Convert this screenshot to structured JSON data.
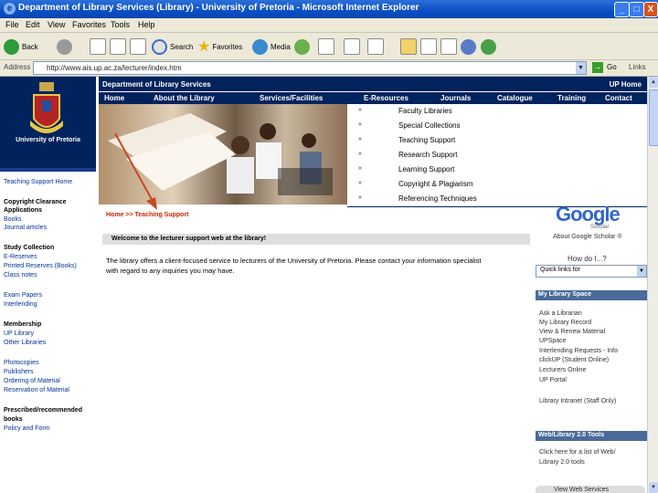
{
  "window": {
    "title": "Department of Library Services (Library) - University of Pretoria - Microsoft Internet Explorer",
    "min": "_",
    "max": "□",
    "close": "X"
  },
  "menu": [
    "File",
    "Edit",
    "View",
    "Favorites",
    "Tools",
    "Help"
  ],
  "toolbar": {
    "back": "Back",
    "search": "Search",
    "favorites": "Favorites",
    "media": "Media"
  },
  "address": {
    "label": "Address",
    "url": "http://www.ais.up.ac.za/lecturer/index.htm",
    "go": "Go",
    "links": "Links"
  },
  "site": {
    "logo_text": "University of Pretoria",
    "dept": "Department of Library Services",
    "up_home": "UP Home",
    "tabs": [
      "Home",
      "About the Library",
      "Services/Facilities",
      "E-Resources",
      "Journals",
      "Catalogue",
      "Training",
      "Contact"
    ],
    "dropdown": [
      "Faculty Libraries",
      "Special Collections",
      "Teaching Support",
      "Research Support",
      "Learning Support",
      "Copyright & Plagiarism",
      "Referencing Techniques"
    ],
    "dropdown_bullet": "»"
  },
  "leftnav": [
    {
      "text": "Teaching Support Home",
      "h": false
    },
    {
      "text": "Copyright Clearance",
      "h": true
    },
    {
      "text": "Applications",
      "h": true
    },
    {
      "text": "Books",
      "h": false
    },
    {
      "text": "Journal articles",
      "h": false
    },
    {
      "text": "Study Collection",
      "h": true
    },
    {
      "text": "E-Reserves",
      "h": false
    },
    {
      "text": "Printed Reserves (Books)",
      "h": false
    },
    {
      "text": "Class notes",
      "h": false
    },
    {
      "text": "Exam Papers",
      "h": false
    },
    {
      "text": "Interlending",
      "h": false
    },
    {
      "text": "Membership",
      "h": true
    },
    {
      "text": "UP Library",
      "h": false
    },
    {
      "text": "Other Libraries",
      "h": false
    },
    {
      "text": "Photocopies",
      "h": false
    },
    {
      "text": "Publishers",
      "h": false
    },
    {
      "text": "Ordering of Material",
      "h": false
    },
    {
      "text": "Reservation of Material",
      "h": false
    },
    {
      "text": "Prescribed/recommended",
      "h": true
    },
    {
      "text": "books",
      "h": true
    },
    {
      "text": "Policy and Form",
      "h": false
    }
  ],
  "main": {
    "breadcrumb": "Home >> Teaching Support",
    "welcome": "Welcome to the lecturer support web at the library!",
    "intro": "The library offers a client-focused service to lecturers of the University of Pretoria. Please contact your information specialist with regard to any inquiries you may have."
  },
  "right": {
    "google_logo": "Google",
    "google_sub": "Scholar",
    "about_gs": "About Google Scholar ®",
    "how_do_i": "How do I...?",
    "quick_select": "Quick links for",
    "my_library_space": "My Library Space",
    "my_library_items": [
      "Ask a Librarian",
      "My Library Record",
      "View & Renew Material",
      "UPSpace",
      "Interlending Requests - Info",
      "clickUP (Student Online)",
      "Lecturers Online",
      "UP Portal",
      "Library Intranet (Staff Only)"
    ],
    "web_tools": "Web/Library 2.0 Tools",
    "web_tools_items": [
      "Click here for a list of Web/",
      "Library 2.0 tools"
    ],
    "view_services": "View Web Services"
  },
  "colors": {
    "navy": "#00235d",
    "breadcrumb": "#cc2200",
    "arrow": "#c8481f"
  }
}
